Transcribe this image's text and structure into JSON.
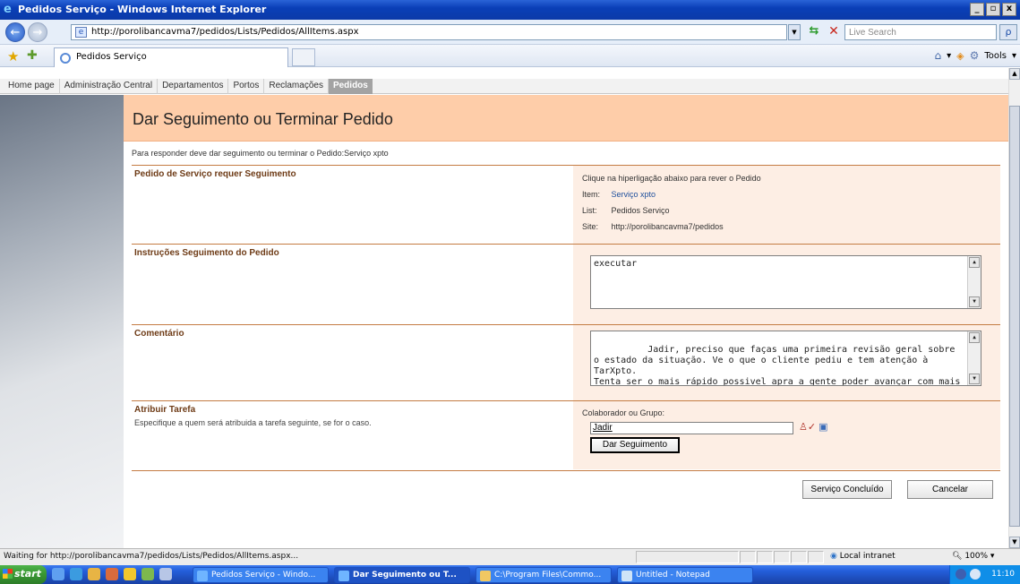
{
  "window": {
    "title": "Pedidos Serviço - Windows Internet Explorer",
    "controls": {
      "minimize": "_",
      "restore": "▫",
      "close": "x"
    }
  },
  "toolbar": {
    "back": "←",
    "forward": "→",
    "address": "http://porolibancavma7/pedidos/Lists/Pedidos/AllItems.aspx",
    "search_placeholder": "Live Search",
    "search_icon": "ρ"
  },
  "tabs": {
    "current_tab": "Pedidos Serviço",
    "tools_label": "Tools"
  },
  "sharepoint": {
    "nav": [
      "Home page",
      "Administração Central",
      "Departamentos",
      "Portos",
      "Reclamações",
      "Pedidos"
    ],
    "active_nav": "Pedidos"
  },
  "page": {
    "title": "Dar Seguimento ou Terminar Pedido",
    "description": "Para responder deve dar seguimento ou terminar o Pedido:Serviço xpto"
  },
  "sections": {
    "review": {
      "label": "Pedido de Serviço requer Seguimento",
      "hint": "Clique na hiperligação abaixo para rever o Pedido",
      "item_key": "Item:",
      "item_value": "Serviço xpto",
      "list_key": "List:",
      "list_value": "Pedidos Serviço",
      "site_key": "Site:",
      "site_value": "http://porolibancavma7/pedidos"
    },
    "instructions": {
      "label": "Instruções Seguimento do Pedido",
      "value": "executar"
    },
    "comment": {
      "label": "Comentário",
      "value": "Jadir, preciso que faças uma primeira revisão geral sobre o estado da situação. Ve o que o cliente pediu e tem atenção à TarXpto.\nTenta ser o mais rápido possivel apra a gente poder avançar com mais desenvolvimentos."
    },
    "assign": {
      "label": "Atribuir Tarefa",
      "sublabel": "Especifique a quem será atribuida a tarefa seguinte, se for o caso.",
      "field_label": "Colaborador ou Grupo:",
      "field_value": "Jadir",
      "forward_button": "Dar Seguimento"
    }
  },
  "actions": {
    "complete": "Serviço Concluído",
    "cancel": "Cancelar"
  },
  "statusbar": {
    "message": "Waiting for http://porolibancavma7/pedidos/Lists/Pedidos/AllItems.aspx...",
    "zone": "Local intranet",
    "zoom": "100%"
  },
  "taskbar": {
    "start": "start",
    "tasks": [
      "Pedidos Serviço - Windo...",
      "Dar Seguimento ou T...",
      "C:\\Program Files\\Commo...",
      "Untitled - Notepad"
    ],
    "clock": "11:10"
  },
  "colors": {
    "header_bg": "#fecda9",
    "section_right_bg": "#fdeee4",
    "section_border": "#c47c43",
    "label_color": "#6e3b16"
  }
}
